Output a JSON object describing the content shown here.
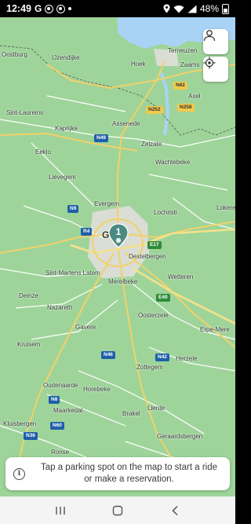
{
  "status_bar": {
    "time": "12:49",
    "g_label": "G",
    "battery": "48%"
  },
  "map": {
    "places": [
      {
        "id": "oostburg",
        "label": "Oostburg"
      },
      {
        "id": "ijzendijke",
        "label": "IJzendijke"
      },
      {
        "id": "hoek",
        "label": "Hoek"
      },
      {
        "id": "terneuzen",
        "label": "Terneuzen"
      },
      {
        "id": "zaamslag",
        "label": "Zaams"
      },
      {
        "id": "axel",
        "label": "Axel"
      },
      {
        "id": "sint-laureins",
        "label": "Sint-Laureins"
      },
      {
        "id": "kaprijke",
        "label": "Kaprijke"
      },
      {
        "id": "assenede",
        "label": "Assenede"
      },
      {
        "id": "zelzate",
        "label": "Zelzate"
      },
      {
        "id": "eeklo",
        "label": "Eeklo"
      },
      {
        "id": "wachtebeke",
        "label": "Wachtebeke"
      },
      {
        "id": "lievegem",
        "label": "Lievegem"
      },
      {
        "id": "evergem",
        "label": "Evergem"
      },
      {
        "id": "lochristi",
        "label": "Lochristi"
      },
      {
        "id": "lokeren",
        "label": "Lokere"
      },
      {
        "id": "gent",
        "label": "G"
      },
      {
        "id": "destelbergen",
        "label": "Destelbergen"
      },
      {
        "id": "sint-martens-latem",
        "label": "Sint-Martens Latem"
      },
      {
        "id": "merelbeke",
        "label": "Merelbeke"
      },
      {
        "id": "wetteren",
        "label": "Wetteren"
      },
      {
        "id": "deinze",
        "label": "Deinze"
      },
      {
        "id": "nazareth",
        "label": "Nazareth"
      },
      {
        "id": "oosterzele",
        "label": "Oosterzele"
      },
      {
        "id": "gavere",
        "label": "Gavere"
      },
      {
        "id": "erpe-mere",
        "label": "Erpe-Mere"
      },
      {
        "id": "kruisem",
        "label": "Kruisem"
      },
      {
        "id": "herzele",
        "label": "Herzele"
      },
      {
        "id": "zottegem",
        "label": "Zottegem"
      },
      {
        "id": "oudenaarde",
        "label": "Oudenaarde"
      },
      {
        "id": "horebeke",
        "label": "Horebeke"
      },
      {
        "id": "maarkedal",
        "label": "Maarkedal"
      },
      {
        "id": "brakel",
        "label": "Brakel"
      },
      {
        "id": "lierde",
        "label": "Lierde"
      },
      {
        "id": "kluisbergen",
        "label": "Kluisbergen"
      },
      {
        "id": "geraardsbergen",
        "label": "Geraardsbergen"
      },
      {
        "id": "ronse",
        "label": "Ronse"
      }
    ],
    "road_shields": [
      {
        "id": "n62",
        "label": "N62",
        "color": "yellow"
      },
      {
        "id": "n252",
        "label": "N252",
        "color": "yellow"
      },
      {
        "id": "n258",
        "label": "N258",
        "color": "yellow"
      },
      {
        "id": "n49",
        "label": "N49",
        "color": "blue"
      },
      {
        "id": "n9",
        "label": "N9",
        "color": "blue"
      },
      {
        "id": "r4",
        "label": "R4",
        "color": "blue"
      },
      {
        "id": "e17",
        "label": "E17",
        "color": "green"
      },
      {
        "id": "e40",
        "label": "E40",
        "color": "green"
      },
      {
        "id": "n46",
        "label": "N46",
        "color": "blue"
      },
      {
        "id": "n42",
        "label": "N42",
        "color": "blue"
      },
      {
        "id": "n8",
        "label": "N8",
        "color": "blue"
      },
      {
        "id": "n60",
        "label": "N60",
        "color": "blue"
      },
      {
        "id": "n36",
        "label": "N36",
        "color": "blue"
      }
    ],
    "cluster_count": "1",
    "colors": {
      "land": "#9ed49a",
      "water": "#a9d3f5",
      "urban": "#d9ddd4",
      "road": "#ffffff",
      "major_road": "#f2d16b",
      "cluster": "#4a8a82"
    }
  },
  "buttons": {
    "profile_icon": "person-icon",
    "locate_icon": "my-location-icon"
  },
  "toast": {
    "message": "Tap a parking spot on the map to start a ride or make a reservation."
  },
  "nav_bar": {
    "recents": "recents-icon",
    "home": "home-icon",
    "back": "back-icon"
  }
}
